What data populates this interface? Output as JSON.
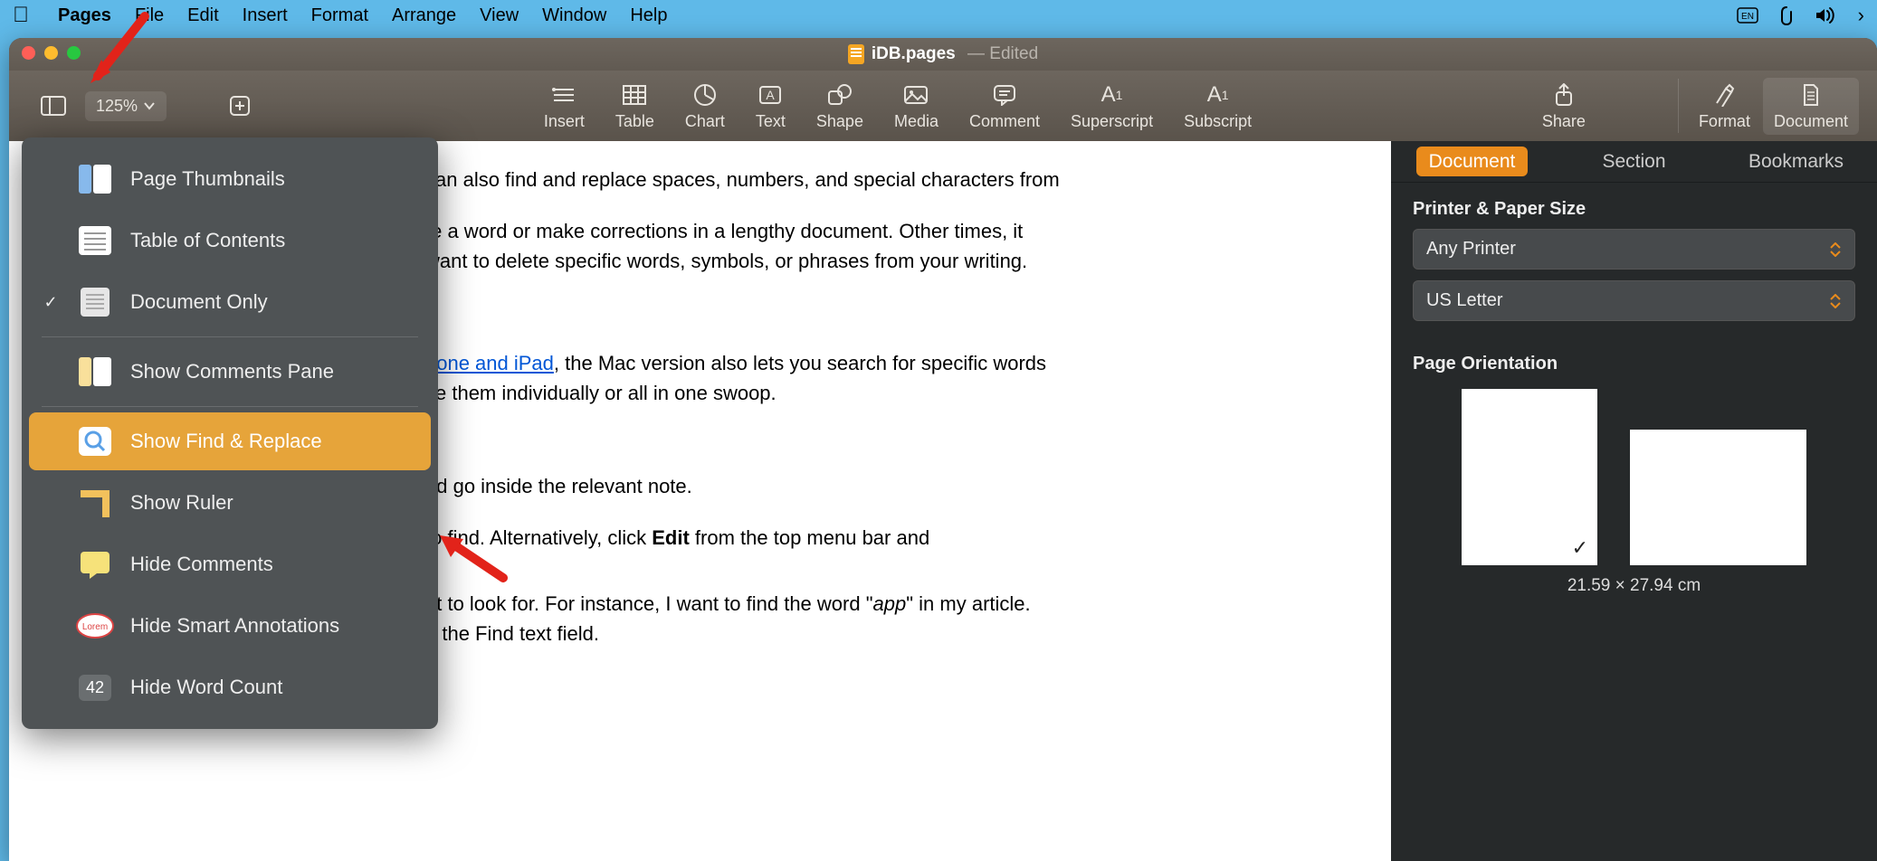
{
  "menubar": {
    "app": "Pages",
    "items": [
      "File",
      "Edit",
      "Insert",
      "Format",
      "Arrange",
      "View",
      "Window",
      "Help"
    ]
  },
  "window": {
    "title_file": "iDB.pages",
    "title_status": "Edited"
  },
  "toolbar": {
    "zoom": "125%",
    "items": {
      "insert": "Insert",
      "table": "Table",
      "chart": "Chart",
      "text": "Text",
      "shape": "Shape",
      "media": "Media",
      "comment": "Comment",
      "superscript": "Superscript",
      "subscript": "Subscript",
      "share": "Share",
      "format": "Format",
      "document": "Document"
    }
  },
  "viewmenu": {
    "page_thumbnails": "Page Thumbnails",
    "table_of_contents": "Table of Contents",
    "document_only": "Document Only",
    "show_comments_pane": "Show Comments Pane",
    "show_find_replace": "Show Find & Replace",
    "show_ruler": "Show Ruler",
    "hide_comments": "Hide Comments",
    "hide_smart_annotations": "Hide Smart Annotations",
    "hide_word_count": "Hide Word Count",
    "wc_badge": "42"
  },
  "document_text": {
    "p1": " can also find and replace spaces, numbers, and special characters from",
    "p2a": "te a word or make corrections in a lengthy document. Other times, it",
    "p2b": " want to delete specific words, symbols, or phrases from your writing.",
    "p3link": "hone and iPad",
    "p3a": ", the Mac version also lets you search for specific words",
    "p3b": "ce them individually or all in one swoop.",
    "p4": "nd go inside the relevant note.",
    "p5a": " to find. Alternatively, click ",
    "p5b": "Edit",
    "p5c": " from the top menu bar and",
    "p6a": "nt to look for. For instance, I want to find the word \"",
    "p6b": "app",
    "p6c": "\" in my article.",
    "p6d": "n the Find text field."
  },
  "inspector": {
    "tabs": {
      "document": "Document",
      "section": "Section",
      "bookmarks": "Bookmarks"
    },
    "printer_header": "Printer & Paper Size",
    "printer": "Any Printer",
    "paper": "US Letter",
    "orientation_header": "Page Orientation",
    "dimensions": "21.59 × 27.94 cm"
  }
}
